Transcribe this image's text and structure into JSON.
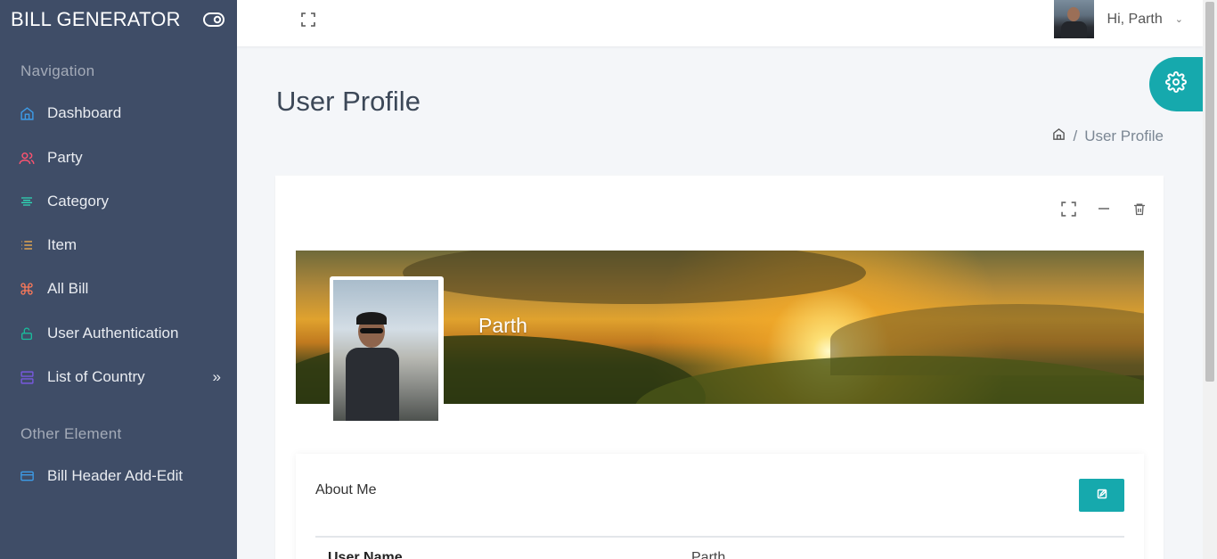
{
  "app": {
    "title": "BILL GENERATOR"
  },
  "sidebar": {
    "caption_navigation": "Navigation",
    "caption_other": "Other Element",
    "items": [
      {
        "label": "Dashboard",
        "icon": "home-icon",
        "color": "#3d9ce8"
      },
      {
        "label": "Party",
        "icon": "users-icon",
        "color": "#ff5370"
      },
      {
        "label": "Category",
        "icon": "align-center-icon",
        "color": "#2ed8b6"
      },
      {
        "label": "Item",
        "icon": "list-icon",
        "color": "#ffb64d"
      },
      {
        "label": "All Bill",
        "icon": "command-icon",
        "color": "#ff7a59"
      },
      {
        "label": "User Authentication",
        "icon": "unlock-icon",
        "color": "#1abc9c"
      },
      {
        "label": "List of Country",
        "icon": "server-icon",
        "color": "#7759de",
        "chevron": "»"
      },
      {
        "label": "Bill Header Add-Edit",
        "icon": "credit-card-icon",
        "color": "#3d9ce8"
      }
    ]
  },
  "header": {
    "greeting": "Hi, Parth",
    "caret": "⌄"
  },
  "page": {
    "title": "User Profile",
    "breadcrumb_current": "User Profile",
    "breadcrumb_sep": "/"
  },
  "profile": {
    "name": "Parth",
    "about_title": "About Me",
    "fields": [
      {
        "label": "User Name",
        "value": "Parth"
      }
    ]
  },
  "colors": {
    "sidebar_bg": "#3f4d67",
    "accent": "#16a9ad",
    "page_bg": "#f4f6f9"
  }
}
